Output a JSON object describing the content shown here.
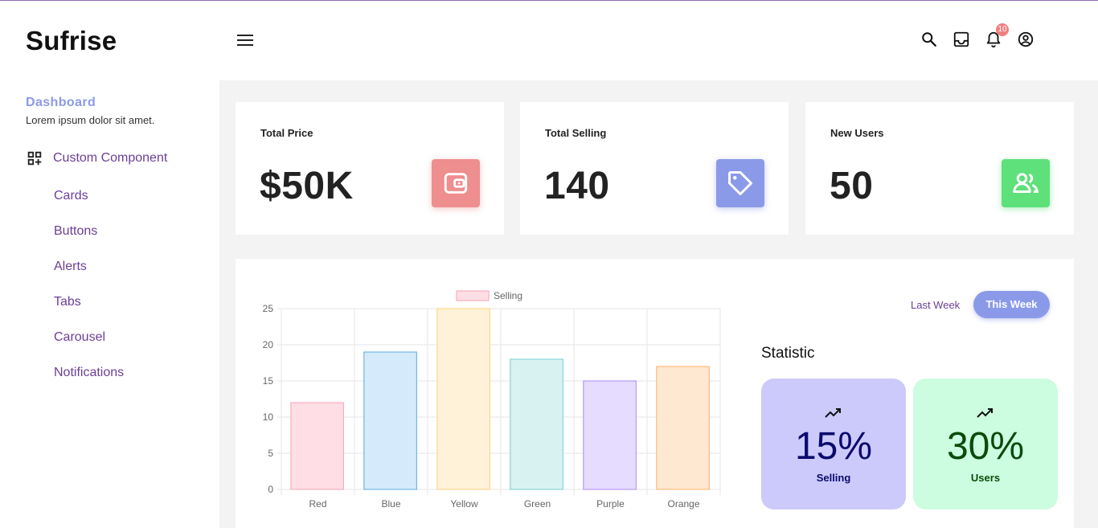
{
  "brand": "Sufrise",
  "sidebar": {
    "dashboard_title": "Dashboard",
    "dashboard_subtitle": "Lorem ipsum dolor sit amet.",
    "section_label": "Custom Component",
    "section_icon": "dashboard-grid-add-icon",
    "items": [
      {
        "label": "Cards"
      },
      {
        "label": "Buttons"
      },
      {
        "label": "Alerts"
      },
      {
        "label": "Tabs"
      },
      {
        "label": "Carousel"
      },
      {
        "label": "Notifications"
      }
    ]
  },
  "header": {
    "icons": [
      "menu-icon",
      "search-icon",
      "inbox-icon",
      "bell-icon",
      "account-icon"
    ],
    "notification_count": "10"
  },
  "cards": [
    {
      "title": "Total Price",
      "value": "$50K",
      "icon": "wallet-icon",
      "color": "#ee8e8e"
    },
    {
      "title": "Total Selling",
      "value": "140",
      "icon": "tag-icon",
      "color": "#8b9ae8"
    },
    {
      "title": "New Users",
      "value": "50",
      "icon": "users-icon",
      "color": "#5ee07a"
    }
  ],
  "toggle": {
    "last_week": "Last Week",
    "this_week": "This Week"
  },
  "statistic": {
    "title": "Statistic",
    "items": [
      {
        "value": "15%",
        "label": "Selling",
        "icon": "trending-up-icon",
        "bg": "#cccafb",
        "fg": "#0b0b6e"
      },
      {
        "value": "30%",
        "label": "Users",
        "icon": "trending-up-icon",
        "bg": "#ccfde0",
        "fg": "#0b4a0b"
      }
    ]
  },
  "chart_data": {
    "type": "bar",
    "categories": [
      "Red",
      "Blue",
      "Yellow",
      "Green",
      "Purple",
      "Orange"
    ],
    "series": [
      {
        "name": "Selling",
        "values": [
          12,
          19,
          25,
          18,
          15,
          17
        ]
      }
    ],
    "ylim": [
      0,
      25
    ],
    "yticks": [
      0,
      5,
      10,
      15,
      20,
      25
    ],
    "grid": true,
    "legend": "top",
    "fills": [
      "#ffdee5",
      "#d5eafa",
      "#fff2d8",
      "#d8f2f2",
      "#e6dcff",
      "#ffe8d2"
    ],
    "strokes": [
      "#f7a1b4",
      "#5aa9e3",
      "#ffd27a",
      "#74cfcf",
      "#a98af7",
      "#ffb064"
    ]
  }
}
